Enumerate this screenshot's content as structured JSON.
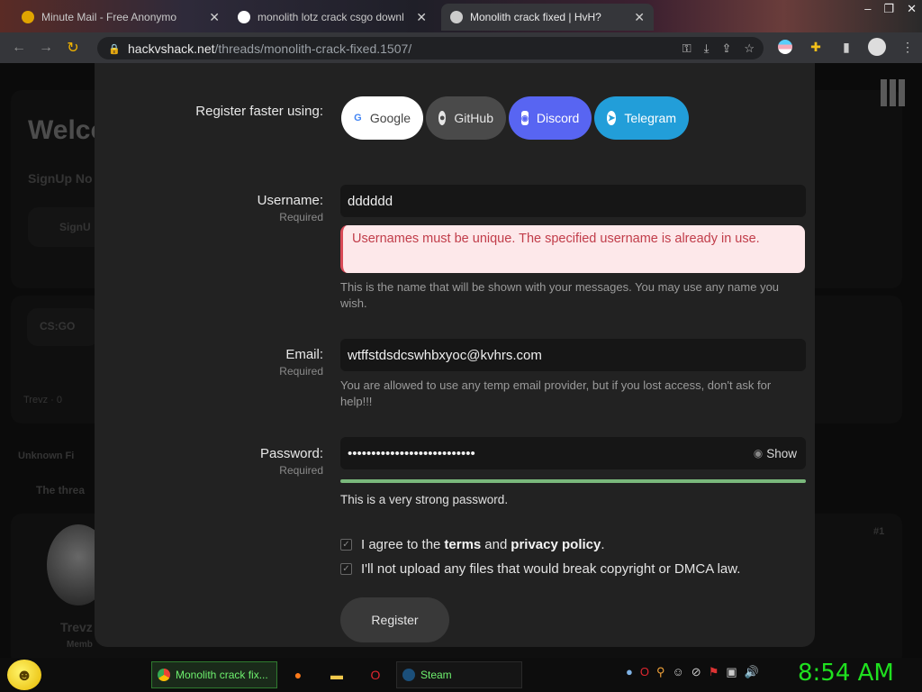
{
  "browser": {
    "tabs": [
      {
        "title": "Minute Mail - Free Anonymo",
        "favicon_color": "#e0a400"
      },
      {
        "title": "monolith lotz crack csgo downl",
        "favicon_color": "#ffffff"
      },
      {
        "title": "Monolith crack fixed | HvH?",
        "favicon_color": "#cccccc"
      }
    ],
    "window_controls": [
      "–",
      "❐",
      "✕"
    ],
    "url_host": "hackvshack.net",
    "url_path": "/threads/monolith-crack-fixed.1507/"
  },
  "background_page": {
    "welcome": "Welco",
    "signup_note": "SignUp No",
    "signup_btn": "SignU",
    "breadcrumb": "CS:GO",
    "author_meta": "Trevz · 0",
    "status_unknown": "Unknown Fi",
    "thread_note": "The threa",
    "user_name": "Trevz",
    "user_role": "Memb",
    "post_num": "#1"
  },
  "form": {
    "social_label": "Register faster using:",
    "social_buttons": {
      "google": "Google",
      "github": "GitHub",
      "discord": "Discord",
      "telegram": "Telegram"
    },
    "username": {
      "label": "Username:",
      "required": "Required",
      "value": "dddddd",
      "error": "Usernames must be unique. The specified username is already in use.",
      "help": "This is the name that will be shown with your messages. You may use any name you wish."
    },
    "email": {
      "label": "Email:",
      "required": "Required",
      "value": "wtffstdsdcswhbxyoc@kvhrs.com",
      "help": "You are allowed to use any temp email provider, but if you lost access, don't ask for help!!!"
    },
    "password": {
      "label": "Password:",
      "required": "Required",
      "value": "•••••••••••••••••••••••••••",
      "show_label": "Show",
      "strength_text": "This is a very strong password.",
      "strength_percent": 100
    },
    "agree_terms": {
      "prefix": "I agree to the",
      "terms": "terms",
      "and": "and",
      "privacy": "privacy policy",
      "suffix": "."
    },
    "agree_copyright": "I'll not upload any files that would break copyright or DMCA law.",
    "register_label": "Register"
  },
  "taskbar": {
    "chrome_task": "Monolith crack fix...",
    "steam_task": "Steam",
    "clock": "8:54 AM"
  }
}
